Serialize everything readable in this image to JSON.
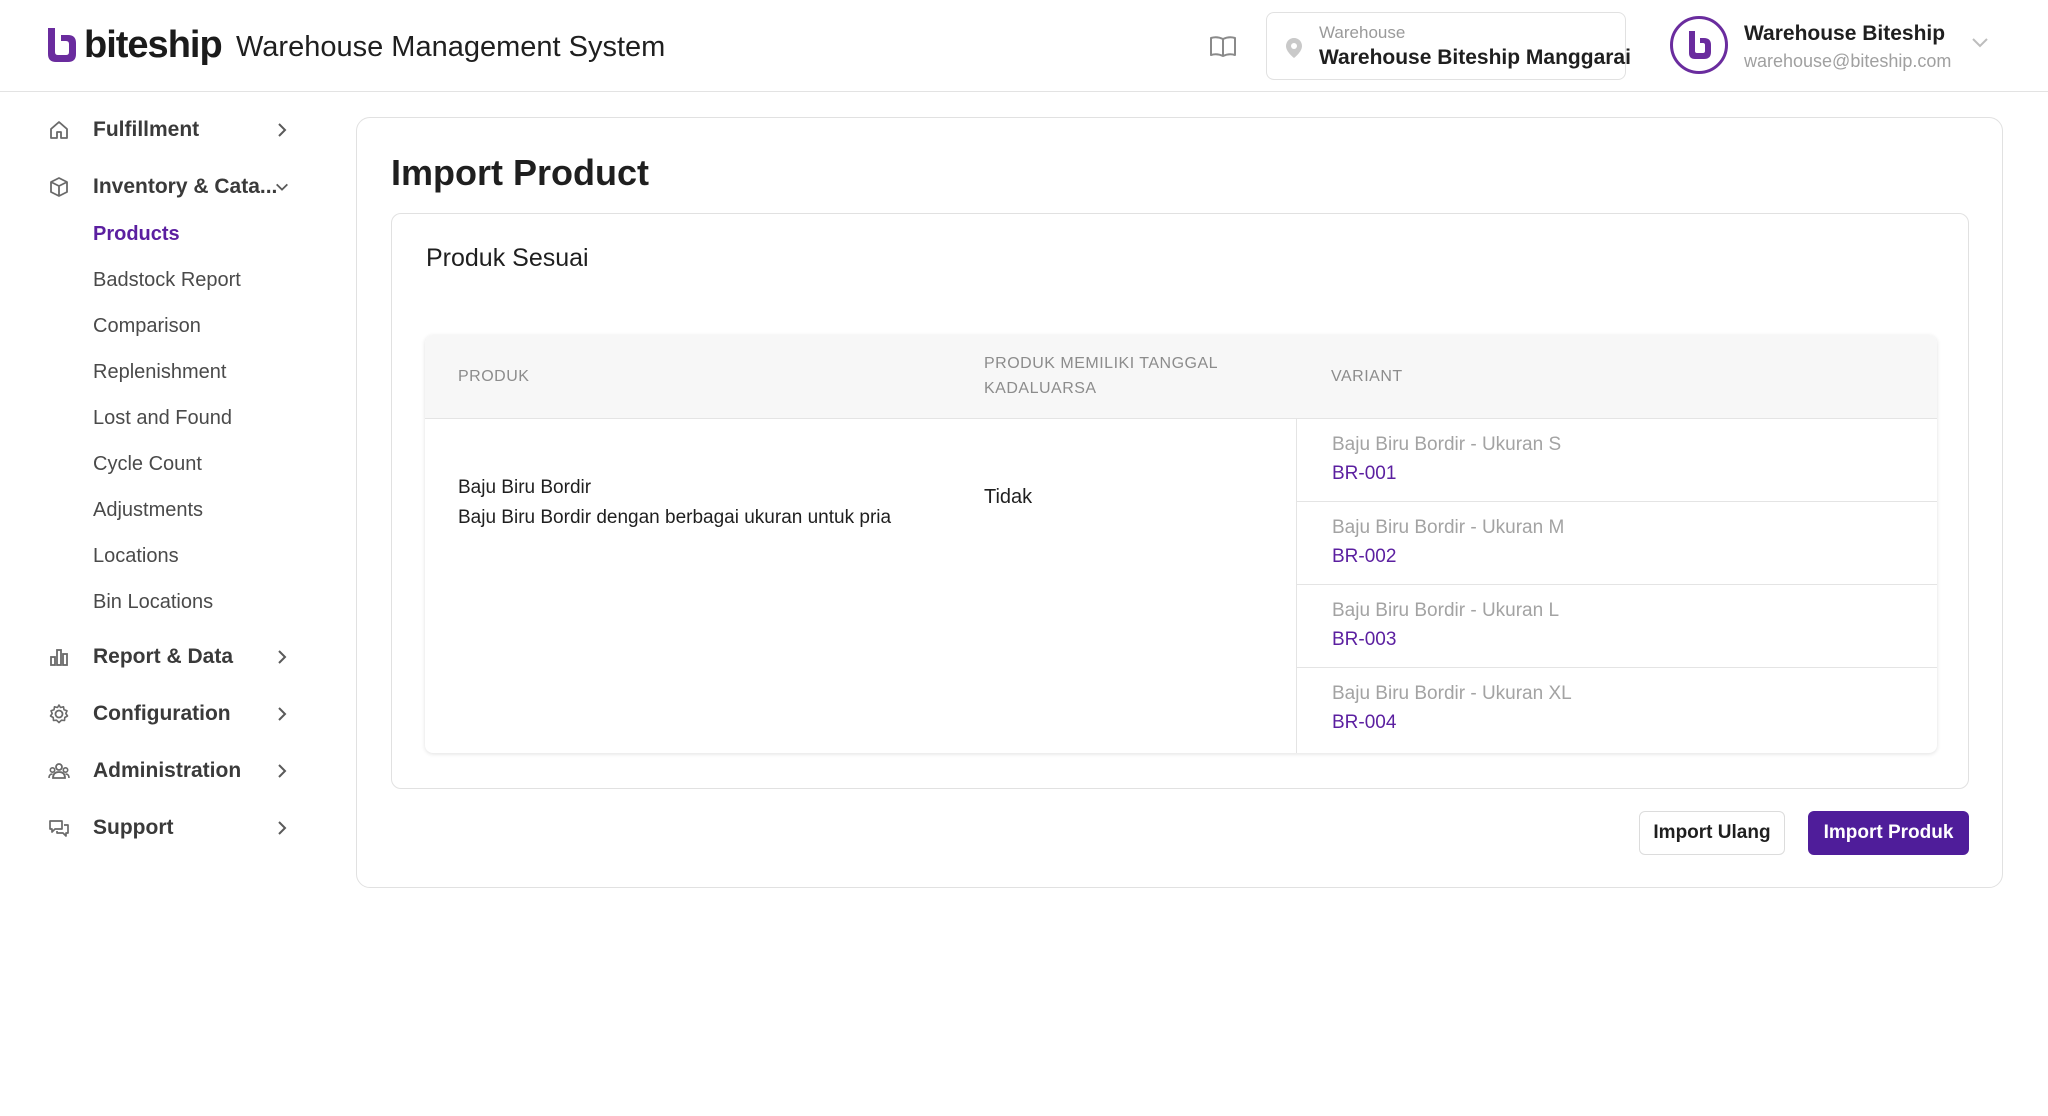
{
  "brand": {
    "logo_text": "biteship",
    "app_title": "Warehouse Management System",
    "accent_color": "#5b1fa0"
  },
  "header": {
    "docs_icon": "book-open-icon",
    "warehouse": {
      "label": "Warehouse",
      "value": "Warehouse Biteship Manggarai"
    },
    "user": {
      "name": "Warehouse Biteship",
      "email": "warehouse@biteship.com"
    }
  },
  "sidebar": {
    "items": [
      {
        "label": "Fulfillment",
        "icon": "home-icon",
        "expanded": false
      },
      {
        "label": "Inventory & Cata...",
        "icon": "box-icon",
        "expanded": true,
        "children": [
          {
            "label": "Products",
            "active": true
          },
          {
            "label": "Badstock Report"
          },
          {
            "label": "Comparison"
          },
          {
            "label": "Replenishment"
          },
          {
            "label": "Lost and Found"
          },
          {
            "label": "Cycle Count"
          },
          {
            "label": "Adjustments"
          },
          {
            "label": "Locations"
          },
          {
            "label": "Bin Locations"
          }
        ]
      },
      {
        "label": "Report & Data",
        "icon": "bar-chart-icon",
        "expanded": false
      },
      {
        "label": "Configuration",
        "icon": "gear-icon",
        "expanded": false
      },
      {
        "label": "Administration",
        "icon": "users-icon",
        "expanded": false
      },
      {
        "label": "Support",
        "icon": "chat-icon",
        "expanded": false
      }
    ]
  },
  "main": {
    "title": "Import Product",
    "section_title": "Produk Sesuai",
    "table": {
      "headers": {
        "product": "PRODUK",
        "expiry_line1": "PRODUK MEMILIKI TANGGAL",
        "expiry_line2": "KADALUARSA",
        "variant": "VARIANT"
      },
      "row": {
        "product_name": "Baju Biru Bordir",
        "product_desc": "Baju Biru Bordir dengan berbagai ukuran untuk pria",
        "has_expiry": "Tidak",
        "variants": [
          {
            "name": "Baju Biru Bordir - Ukuran S",
            "sku": "BR-001"
          },
          {
            "name": "Baju Biru Bordir - Ukuran M",
            "sku": "BR-002"
          },
          {
            "name": "Baju Biru Bordir - Ukuran L",
            "sku": "BR-003"
          },
          {
            "name": "Baju Biru Bordir - Ukuran XL",
            "sku": "BR-004"
          }
        ]
      }
    },
    "buttons": {
      "reimport": "Import Ulang",
      "import": "Import Produk"
    }
  }
}
